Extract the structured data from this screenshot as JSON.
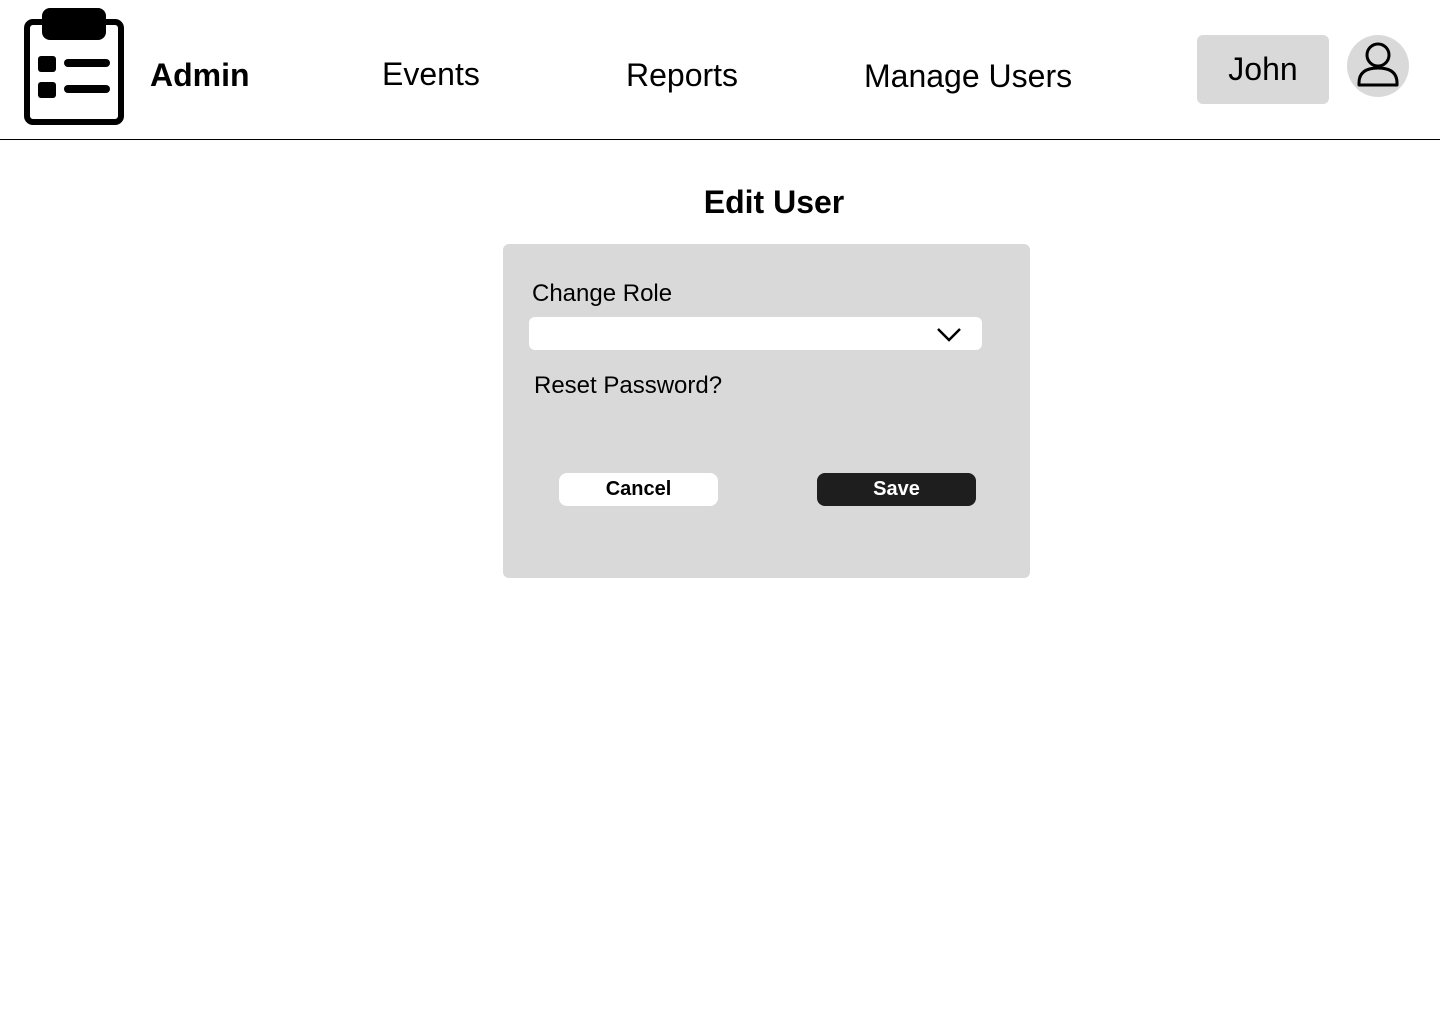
{
  "header": {
    "brand": "Admin",
    "logo_icon": "clipboard-list-icon",
    "nav": {
      "events": "Events",
      "reports": "Reports",
      "manage_users": "Manage Users"
    },
    "user_name": "John",
    "avatar_icon": "user-icon"
  },
  "main": {
    "title": "Edit User",
    "form": {
      "role_label": "Change Role",
      "role_value": "",
      "role_dropdown_icon": "chevron-down-icon",
      "reset_password": "Reset Password?",
      "cancel_label": "Cancel",
      "save_label": "Save"
    }
  },
  "colors": {
    "card_bg": "#d9d9d9",
    "save_bg": "#1e1e1e",
    "cancel_bg": "#ffffff"
  }
}
